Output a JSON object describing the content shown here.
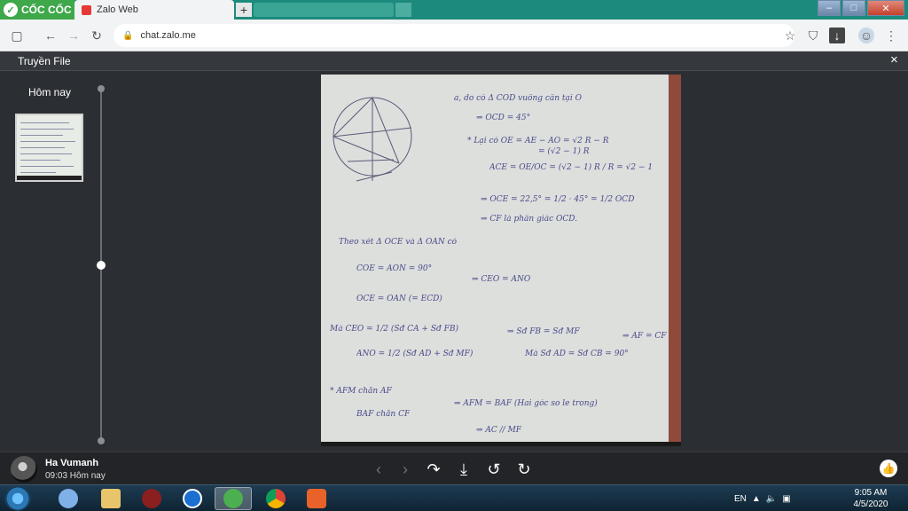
{
  "browser": {
    "brand": "CỐC CỐC",
    "active_tab": "Zalo Web",
    "new_tab_label": "+",
    "url": "chat.zalo.me"
  },
  "viewer": {
    "title": "Truyền File",
    "close_label": "×",
    "sidebar_date": "Hôm nay"
  },
  "sender": {
    "name": "Ha Vumanh",
    "time": "09:03 Hôm nay"
  },
  "photo_text": {
    "lines": [
      "a, do có Δ COD vuông cân tại O",
      "⇒ ÔCD = 45°",
      "* Lại có OE = AE − AO = √2 R − R",
      "= (√2 − 1) R",
      "ÂCE = OE/OC = (√2 − 1) R / R = √2 − 1",
      "⇒ ÔCE = 22,5° = 1/2 · 45° = 1/2 ÔCD",
      "⇒ CF là phân giác ÔCD.",
      "Theo xét Δ OCE và Δ OAN có",
      "ĈOE = ÂON = 90°",
      "ÔCE = ÔAN (= ÊCD)",
      "⇒ ĈEO = ÂNO",
      "Mà ĈEO = 1/2 (Sđ CA + Sđ FB)",
      "ÂNO = 1/2 (Sđ AD + Sđ MF)",
      "⇒ Sđ FB = Sđ MF",
      "Mà Sđ AD = Sđ CB = 90°",
      "⇒ AF = CF",
      "* AFM chắn AF",
      "BAF chắn CF",
      "⇒ AFM = BAF (Hai góc so le trong)",
      "⇒ AC // MF"
    ]
  },
  "tray": {
    "lang": "EN",
    "time": "9:05 AM",
    "date": "4/5/2020"
  }
}
